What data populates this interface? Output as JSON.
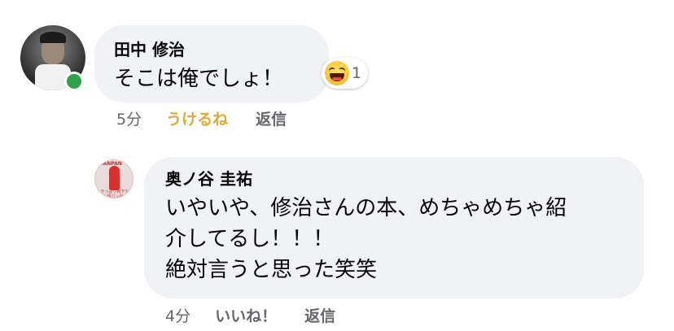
{
  "comments": [
    {
      "author": "田中 修治",
      "text": "そこは俺でしょ！",
      "reaction": {
        "icon": "haha-icon",
        "count": "1"
      },
      "time": "5分",
      "like_label": "うけるね",
      "reply_label": "返信",
      "online": true
    },
    {
      "author": "奥ノ谷 圭祐",
      "text": "いやいや、修治さんの本、めちゃめちゃ紹\n介してるし！！！\n絶対言うと思った笑笑",
      "time": "4分",
      "like_label": "いいね！",
      "reply_label": "返信",
      "avatar_logo": "TANPAN",
      "avatar_caption": "やっぱり靴下なら 短パン社長"
    }
  ],
  "colors": {
    "bubble": "#f0f2f5",
    "meta_text": "#65676b",
    "reacted_like": "#e0a93a",
    "online": "#31a24c"
  }
}
